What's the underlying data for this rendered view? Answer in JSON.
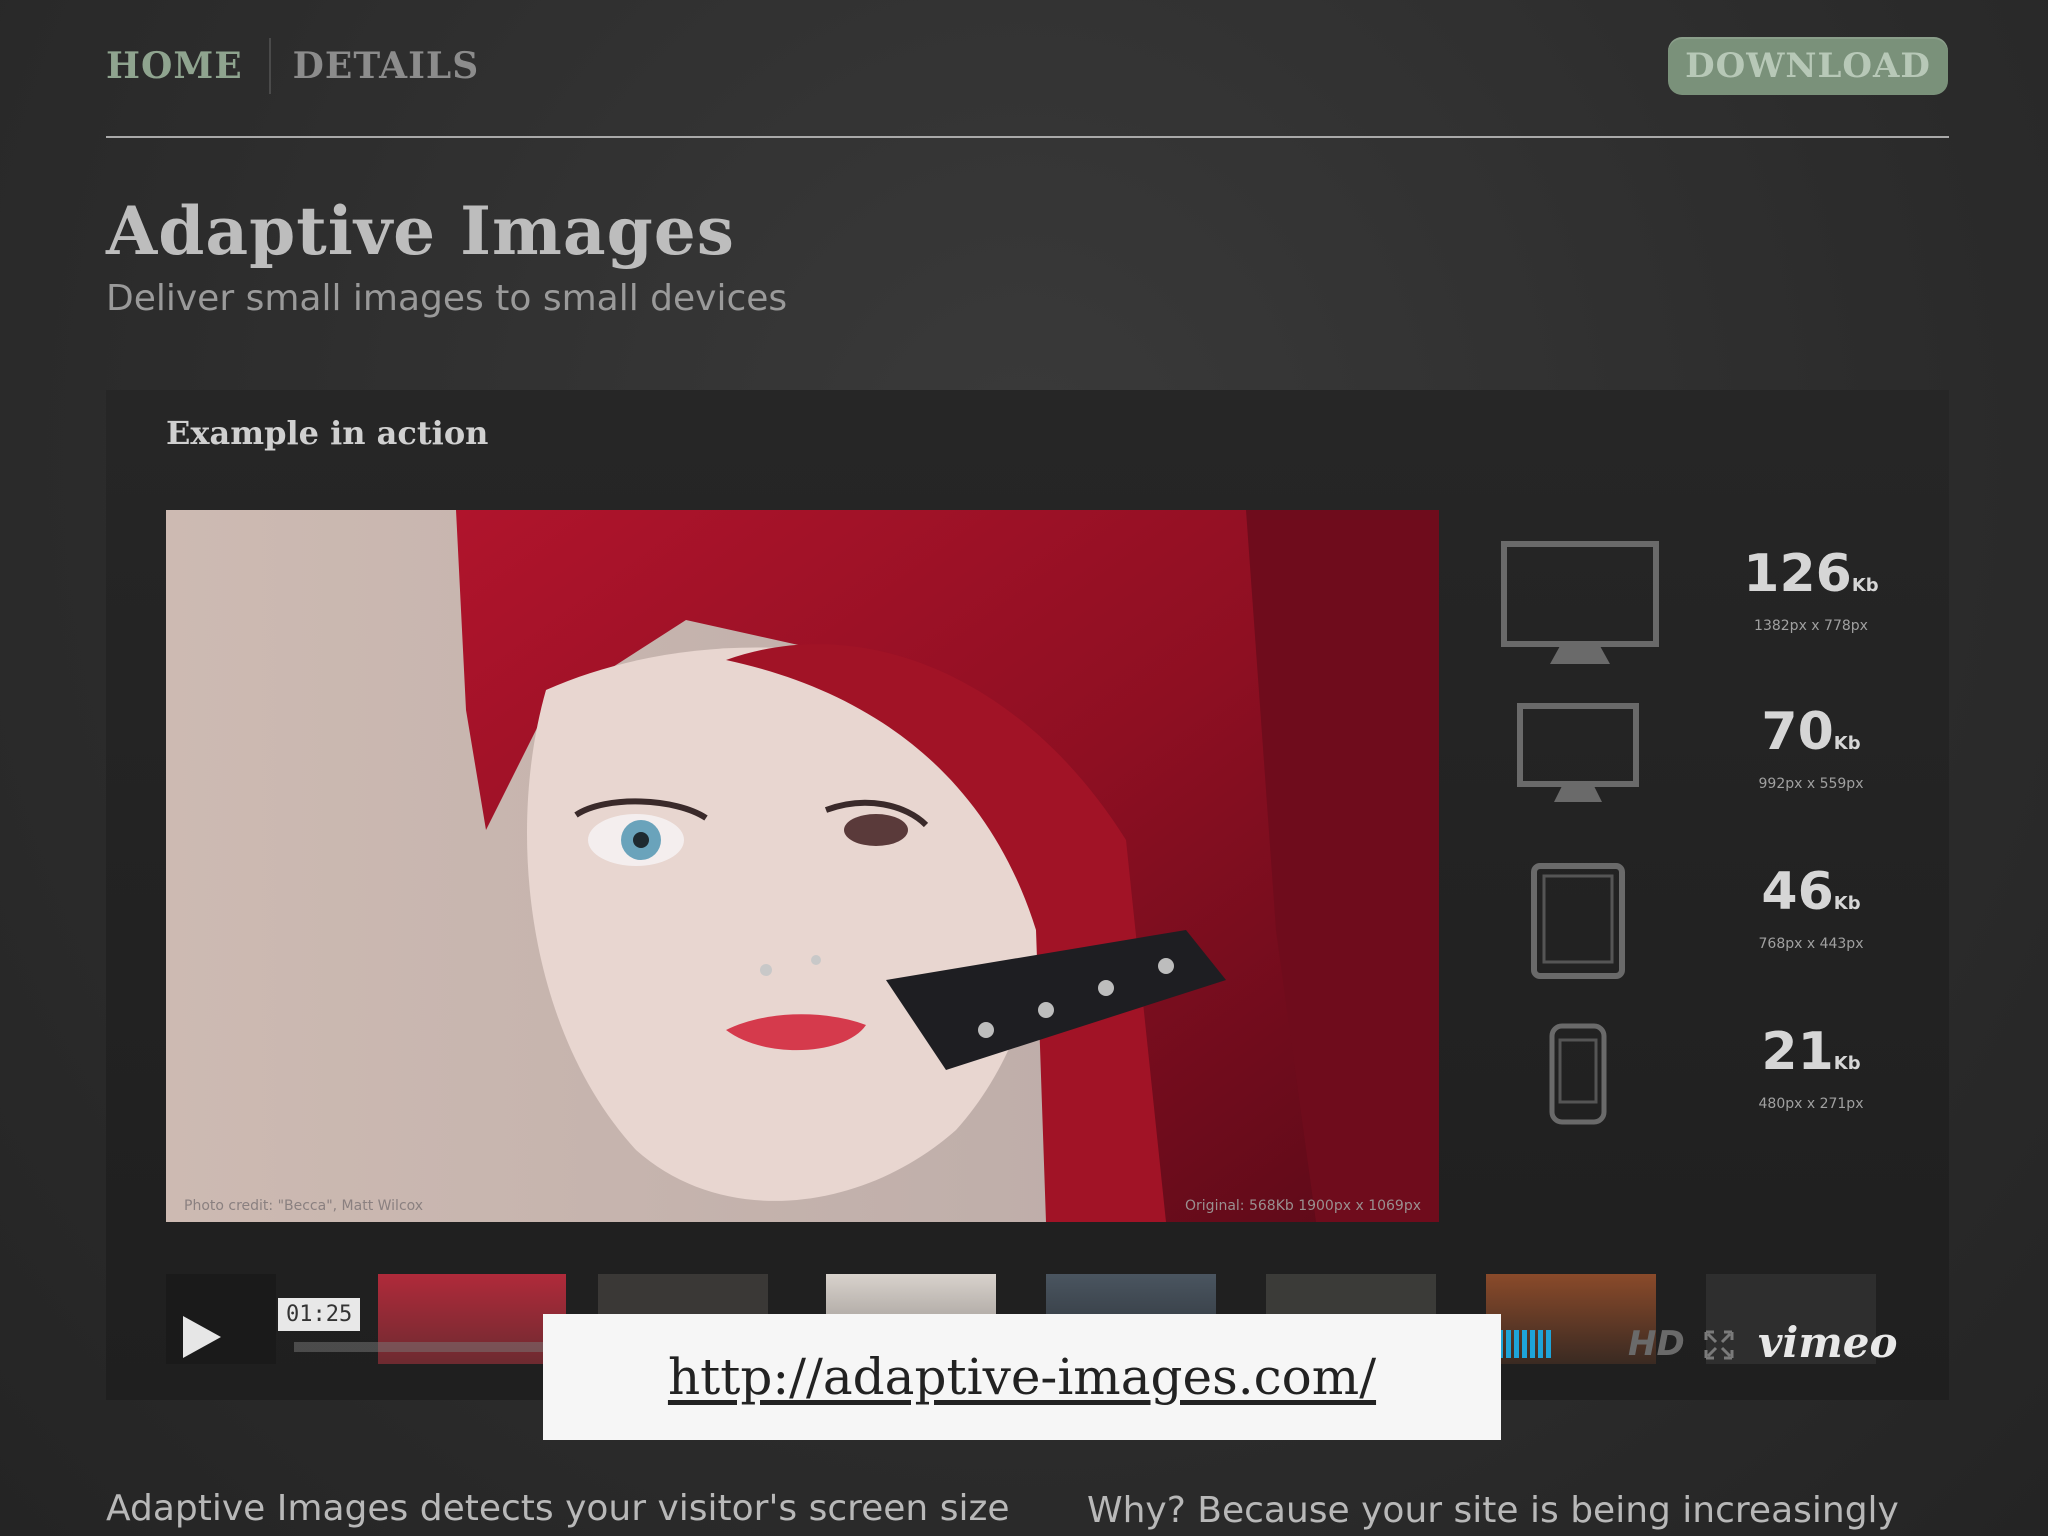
{
  "nav": {
    "home": "HOME",
    "details": "DETAILS",
    "download": "DOWNLOAD"
  },
  "header": {
    "title": "Adaptive Images",
    "subtitle": "Deliver small images to small devices"
  },
  "example": {
    "heading": "Example in action",
    "photo_credit": "Photo credit: \"Becca\", Matt Wilcox",
    "photo_original": "Original: 568Kb 1900px x 1069px",
    "sizes": [
      {
        "device": "desktop-large",
        "value": "126",
        "unit": "Kb",
        "dims": "1382px x 778px"
      },
      {
        "device": "desktop-small",
        "value": "70",
        "unit": "Kb",
        "dims": "992px x 559px"
      },
      {
        "device": "tablet",
        "value": "46",
        "unit": "Kb",
        "dims": "768px x 443px"
      },
      {
        "device": "phone",
        "value": "21",
        "unit": "Kb",
        "dims": "480px x 271px"
      }
    ]
  },
  "video": {
    "timecode": "01:25",
    "hd": "HD",
    "brand": "vimeo"
  },
  "url": "http://adaptive-images.com/",
  "body": {
    "left": "Adaptive Images detects your visitor's screen size",
    "right": "Why? Because your site is being increasingly"
  },
  "colors": {
    "accent_green": "#7a917a",
    "vimeo_blue": "#1ea4d8"
  }
}
